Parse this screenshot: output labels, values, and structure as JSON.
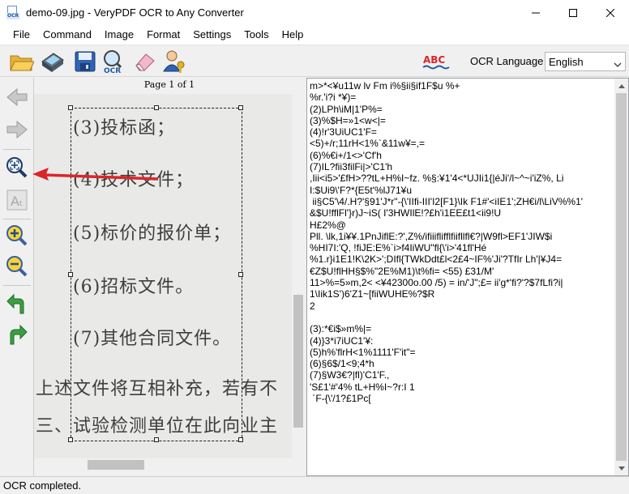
{
  "window": {
    "title": "demo-09.jpg - VeryPDF OCR to Any Converter",
    "minimize_icon": "minimize-icon",
    "maximize_icon": "maximize-icon",
    "close_icon": "close-icon"
  },
  "menu": [
    "File",
    "Command",
    "Image",
    "Format",
    "Settings",
    "Tools",
    "Help"
  ],
  "toolbar": {
    "buttons": [
      "open-folder-icon",
      "scanner-icon",
      "save-icon",
      "ocr-search-icon",
      "eraser-icon",
      "user-key-icon"
    ],
    "ocr_icon_text": "OCR",
    "spell_icon_text": "ABC",
    "ocr_language_label": "OCR Language",
    "ocr_language_value": "English"
  },
  "left_tools": [
    "back-arrow-icon",
    "forward-arrow-icon",
    "fit-page-icon",
    "text-size-icon",
    "zoom-in-icon",
    "zoom-out-icon",
    "rotate-left-icon",
    "rotate-right-icon"
  ],
  "image_view": {
    "page_label": "Page 1 of 1",
    "lines": [
      "(3)投标函；",
      "(4)技术文件；",
      "(5)标价的报价单；",
      "(6)招标文件。",
      "(7)其他合同文件。",
      "上述文件将互相补充，若有不",
      "三、试验检测单位在此向业主"
    ]
  },
  "ocr_output": {
    "text": "m>*<¥u11w lv Fm i%§ii§if1F$u %+\n%r.'i?i *¥)=\n(2)LPh\\iM|1'P%=\n(3)%$H=»1<w<|=\n(4)!r'3UiUC1'F=\n<5)+/r;11rH<1%`&11w¥=,=\n(6)%€i+/1<>'Cf'h\n(7)IL?fii3filFi|>'C1'h\n,Iii<i5>'£fH>??tL+H%I~fz. %§:¥1'4<*UJIi1{|éJi'/l~^~i'iZ%, Li\nI:$Ui9\\'F?*{E5t'%lJ71¥u\n ii§C5'\\4/.H?'§91'J*r\"-{\\'IIfi-III'I2[F1}\\Ik F1#'<iIE1';ZH€i/l\\LiV%%1'\n&$U!fflFl'}r)J~iS( I'3HWIlE!?£h'i1EE£t1<ii9!U\nH£2%@\nPll. \\lk,1i¥¥.1PnJiflE:?',Z%/ifiiiflifflfiifllfl€?|W9fl>EF1'JIW$i\n%HI7I:'Q, !fiJE:E%`i>f4IiWU\"fl{\\'i>'41fl'Hé\n%1.r}i1E1!K\\2K>';DIfl{TWkDdt£l<2£4~IF%'Ji'?TfIr Lh'|¥J4=\n€Z$U!flHH§$%\"2E%M1)\\t%fi= <55) £31/M'\n11>%=5»m,2< <¥42300o.00 /5) = in/'J\";£= ii'g*'fi?'?$7fLfi?i|\n1\\Iik1S')6'Z1~[fiiWUHE%?$R\n2\n\n(3):*€i$»m%|=\n(4)}3*i7iUC1'¥:\n(5)h%'flrH<1%1111'F'it\"=\n(6)§6$/1<9;4*h\n(7)§W3€?|fl)'C1'F.,\n'S£1'#'4% tL+H%I~?r:I 1\n ´F-{\\'/1?£1Pc["
  },
  "status": {
    "text": "OCR completed."
  },
  "colors": {
    "accent": "#1e5aa8",
    "pointer_arrow": "#d9262b"
  }
}
